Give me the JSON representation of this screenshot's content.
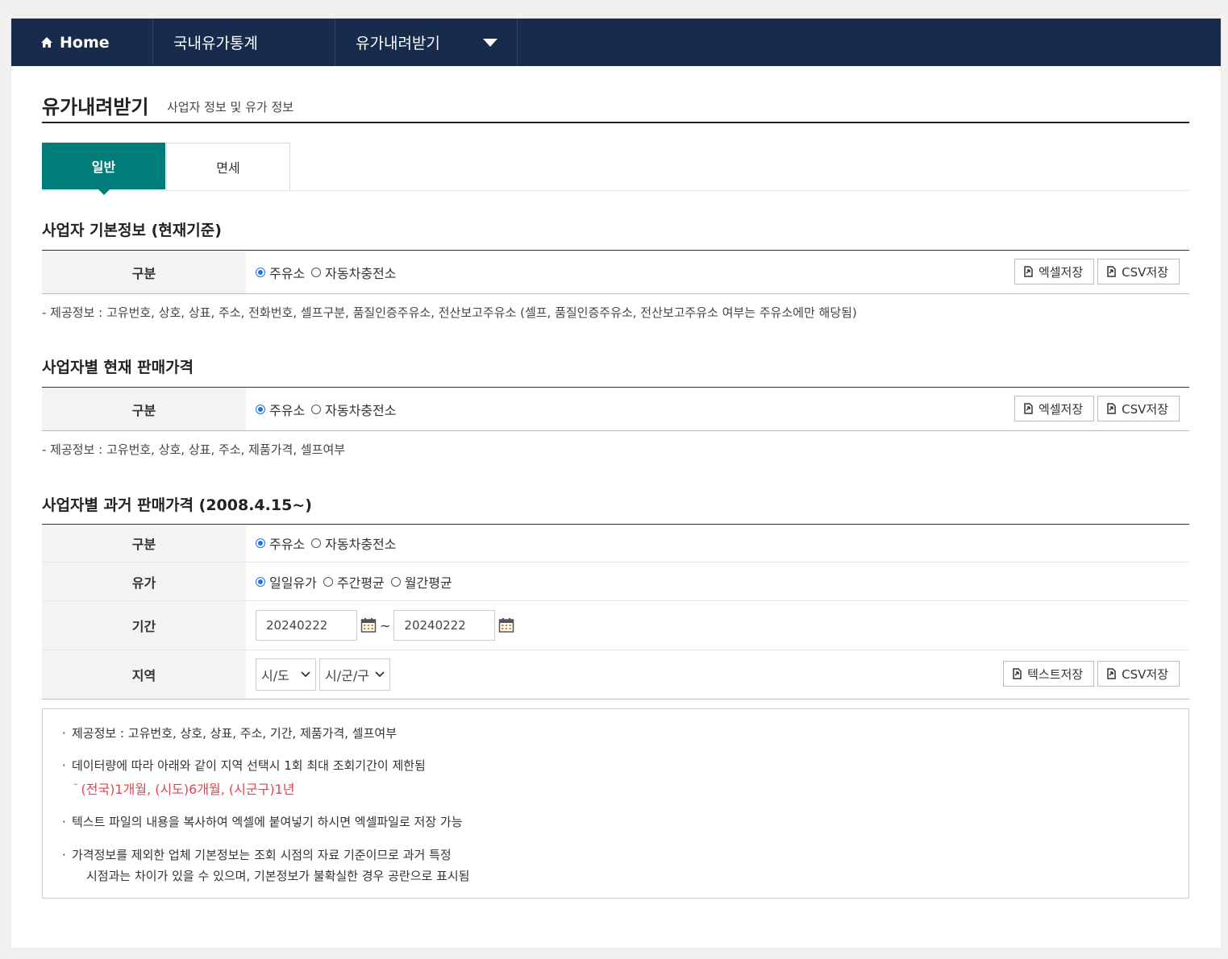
{
  "nav": {
    "home": "Home",
    "stats": "국내유가통계",
    "download": "유가내려받기"
  },
  "header": {
    "title": "유가내려받기",
    "subtitle": "사업자 정보 및 유가 정보"
  },
  "tabs": [
    {
      "label": "일반",
      "active": true
    },
    {
      "label": "면세",
      "active": false
    }
  ],
  "section1": {
    "title": "사업자 기본정보 (현재기준)",
    "row_label": "구분",
    "radios": [
      "주유소",
      "자동차충전소"
    ],
    "selected": "주유소",
    "buttons": [
      "엑셀저장",
      "CSV저장"
    ],
    "note": "- 제공정보 : 고유번호, 상호, 상표, 주소, 전화번호, 셀프구분, 품질인증주유소, 전산보고주유소 (셀프, 품질인증주유소, 전산보고주유소 여부는 주유소에만 해당됨)"
  },
  "section2": {
    "title": "사업자별 현재 판매가격",
    "row_label": "구분",
    "radios": [
      "주유소",
      "자동차충전소"
    ],
    "selected": "주유소",
    "buttons": [
      "엑셀저장",
      "CSV저장"
    ],
    "note": "- 제공정보 : 고유번호, 상호, 상표, 주소, 제품가격, 셀프여부"
  },
  "section3": {
    "title": "사업자별 과거 판매가격 (2008.4.15~)",
    "rows": {
      "type_label": "구분",
      "type_radios": [
        "주유소",
        "자동차충전소"
      ],
      "price_label": "유가",
      "price_radios": [
        "일일유가",
        "주간평균",
        "월간평균"
      ],
      "period_label": "기간",
      "date_from": "20240222",
      "date_sep": "~",
      "date_to": "20240222",
      "region_label": "지역",
      "sido": "시/도",
      "sigungu": "시/군/구"
    },
    "buttons": [
      "텍스트저장",
      "CSV저장"
    ]
  },
  "info": {
    "line1": "제공정보 : 고유번호, 상호, 상표, 주소, 기간, 제품가격, 셀프여부",
    "line2": "데이터량에 따라 아래와 같이 지역 선택시 1회 최대 조회기간이 제한됨",
    "line2_sub": "(전국)1개월, (시도)6개월, (시군구)1년",
    "line3": "텍스트 파일의 내용을 복사하여 엑셀에 붙여넣기 하시면 엑셀파일로 저장 가능",
    "line4a": "가격정보를 제외한 업체 기본정보는 조회 시점의 자료 기준이므로 과거 특정",
    "line4b": "시점과는 차이가 있을 수 있으며, 기본정보가 불확실한 경우 공란으로 표시됨"
  },
  "colors": {
    "nav_bg": "#172b4d",
    "tab_active": "#007d7a",
    "radio_on": "#1a73e8",
    "warn_text": "#e0444f"
  }
}
